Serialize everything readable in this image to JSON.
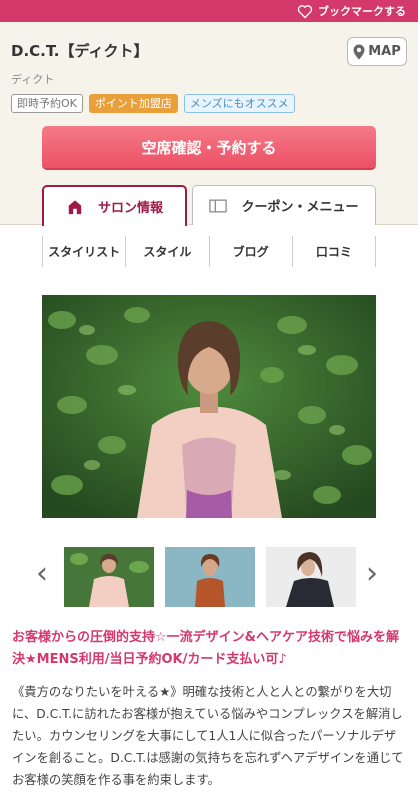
{
  "bookmark": {
    "label": "ブックマークする",
    "icon": "heart-outline-icon"
  },
  "salon": {
    "name": "D.C.T.【ディクト】",
    "kana": "ディクト"
  },
  "map_button": {
    "label": "MAP",
    "icon": "map-pin-icon"
  },
  "tags": [
    "即時予約OK",
    "ポイント加盟店",
    "メンズにもオススメ"
  ],
  "reserve_button": {
    "label": "空席確認・予約する"
  },
  "tabs": [
    {
      "label": "サロン情報",
      "icon": "home-icon",
      "active": true
    },
    {
      "label": "クーポン・メニュー",
      "icon": "coupon-book-icon",
      "active": false
    }
  ],
  "subnav": [
    "スタイリスト",
    "スタイル",
    "ブログ",
    "口コミ"
  ],
  "carousel": {
    "prev": "‹",
    "next": "›"
  },
  "catch_copy": "お客様からの圧倒的支持☆一流デザイン&ヘアケア技術で悩みを解決★MENS利用/当日予約OK/カード支払い可♪",
  "description": "《貴方のなりたいを叶える★》明確な技術と人と人との繋がりを大切に、D.C.T.に訪れたお客様が抱えている悩みやコンプレックスを解消したい。カウンセリングを大事にして1人1人に似合ったパーソナルデザインを創ること。D.C.T.は感謝の気持ちを忘れずヘアデザインを通じてお客様の笑顔を作る事を約束します。",
  "colors": {
    "brand": "#d4396b",
    "active_tab": "#9e1b45",
    "reserve": "#ec5165"
  }
}
